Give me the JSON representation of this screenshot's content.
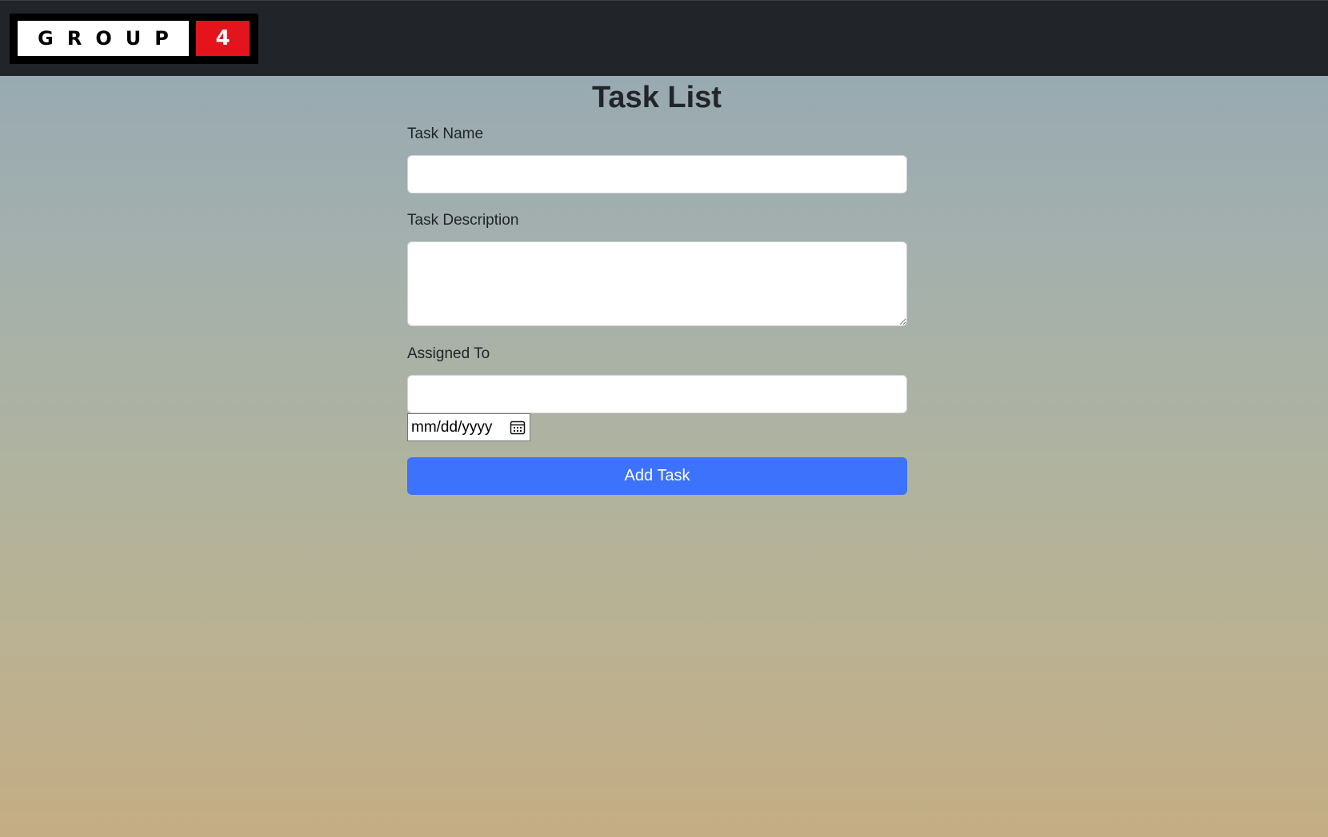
{
  "brand": {
    "word": "GROUP",
    "number": "4"
  },
  "page": {
    "title": "Task List"
  },
  "form": {
    "task_name_label": "Task Name",
    "task_name_value": "",
    "task_description_label": "Task Description",
    "task_description_value": "",
    "assigned_to_label": "Assigned To",
    "assigned_to_value": "",
    "date_placeholder": "mm/dd/yyyy",
    "submit_label": "Add Task"
  },
  "colors": {
    "navbar": "#212529",
    "logo_red": "#e3141b",
    "button": "#3c72fc"
  },
  "icons": {
    "date_picker": "calendar-icon"
  }
}
